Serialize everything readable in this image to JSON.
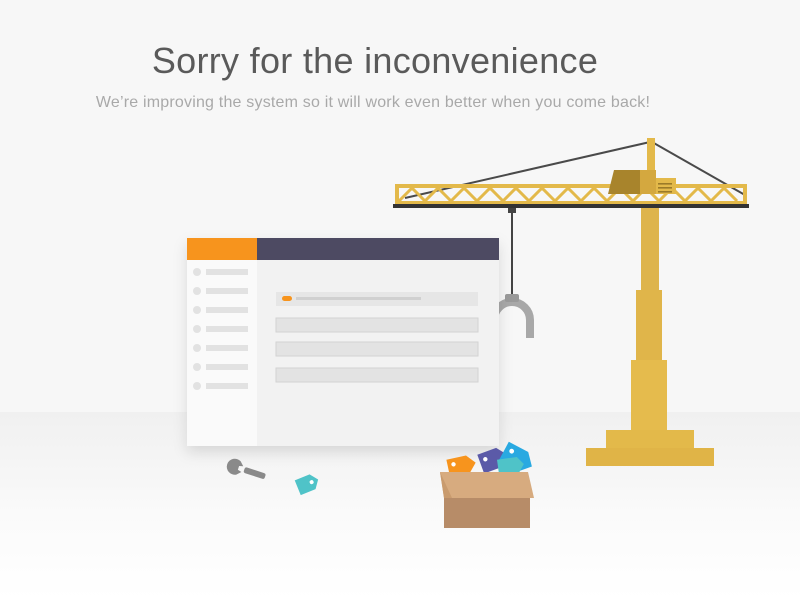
{
  "heading": {
    "title": "Sorry for the inconvenience",
    "subtitle": "We’re improving the system so it will work even better when you come back!"
  },
  "illustration": {
    "window": {
      "header_accent_color": "#f7941d",
      "header_color": "#4d4a62",
      "sidebar_items": 7,
      "form_fields": 3
    },
    "crane_color": "#e3b94a",
    "tag_colors": [
      "#f7941d",
      "#5b5aa8",
      "#29a9e1",
      "#4fc3c8"
    ],
    "box_color": "#c9996b",
    "icons": [
      "wrench-icon",
      "price-tag-icon"
    ]
  }
}
